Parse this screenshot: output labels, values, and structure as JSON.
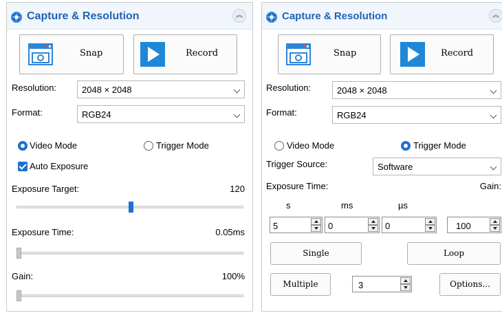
{
  "left_panel": {
    "title": "Capture & Resolution",
    "snap_label": "Snap",
    "record_label": "Record",
    "resolution_label": "Resolution:",
    "resolution_value": "2048 × 2048",
    "format_label": "Format:",
    "format_value": "RGB24",
    "video_mode_label": "Video Mode",
    "video_mode_selected": true,
    "trigger_mode_label": "Trigger Mode",
    "trigger_mode_selected": false,
    "auto_exposure_label": "Auto Exposure",
    "auto_exposure_checked": true,
    "exposure_target_label": "Exposure Target:",
    "exposure_target_value": "120",
    "exposure_time_label": "Exposure Time:",
    "exposure_time_value": "0.05ms",
    "gain_label": "Gain:",
    "gain_value": "100%"
  },
  "right_panel": {
    "title": "Capture & Resolution",
    "snap_label": "Snap",
    "record_label": "Record",
    "resolution_label": "Resolution:",
    "resolution_value": "2048 × 2048",
    "format_label": "Format:",
    "format_value": "RGB24",
    "video_mode_label": "Video Mode",
    "video_mode_selected": false,
    "trigger_mode_label": "Trigger Mode",
    "trigger_mode_selected": true,
    "trigger_source_label": "Trigger Source:",
    "trigger_source_value": "Software",
    "exposure_time_label": "Exposure Time:",
    "gain_label": "Gain:",
    "unit_s": "s",
    "unit_ms": "ms",
    "unit_us": "µs",
    "seconds_value": "5",
    "ms_value": "0",
    "us_value": "0",
    "gain_value": "100",
    "single_label": "Single",
    "loop_label": "Loop",
    "multiple_label": "Multiple",
    "multiple_count": "3",
    "options_label": "Options..."
  },
  "icons": {
    "header": "aperture-icon",
    "collapse": "double-chevron-up-icon",
    "snap": "camera-icon",
    "record": "play-icon"
  },
  "colors": {
    "accent": "#1f6fd0",
    "title": "#1f63b3",
    "header_bg": "#f1f6fc"
  }
}
